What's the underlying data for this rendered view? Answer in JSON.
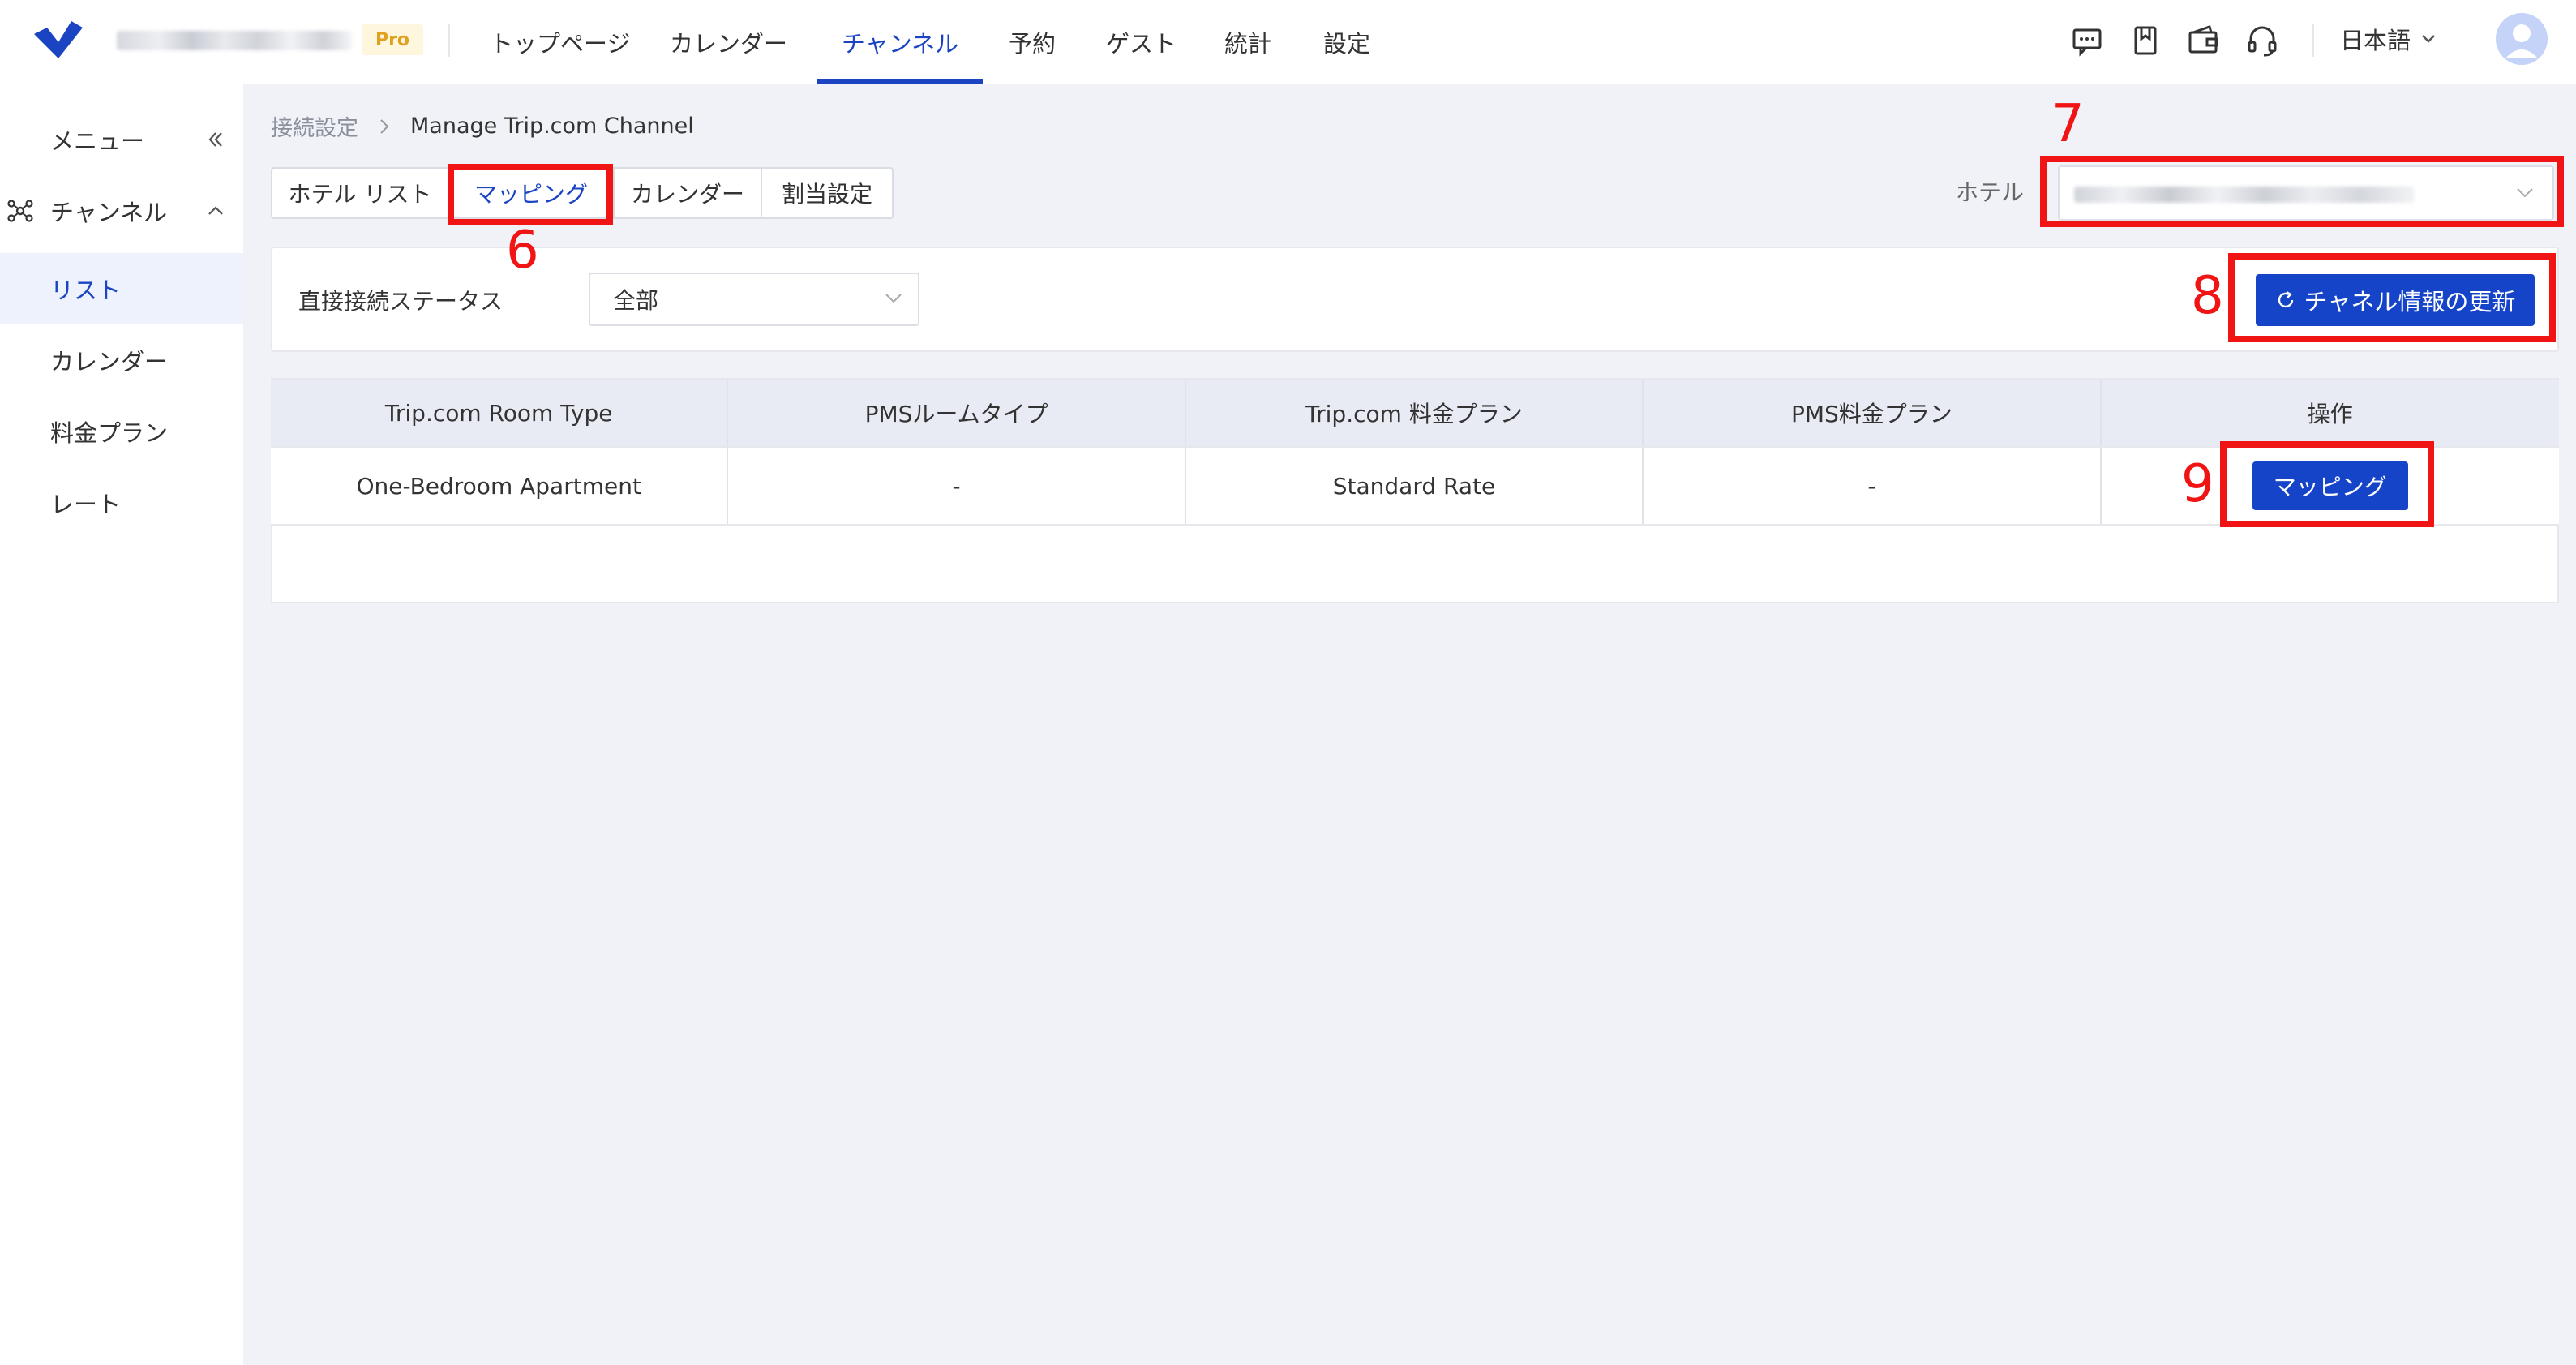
{
  "header": {
    "brand_name": "",
    "pro_badge": "Pro",
    "nav": [
      {
        "label": "トップページ",
        "active": false
      },
      {
        "label": "カレンダー",
        "active": false
      },
      {
        "label": "チャンネル",
        "active": true
      },
      {
        "label": "予約",
        "active": false
      },
      {
        "label": "ゲスト",
        "active": false
      },
      {
        "label": "統計",
        "active": false
      },
      {
        "label": "設定",
        "active": false
      }
    ],
    "icons": [
      "message-icon",
      "bookmark-icon",
      "wallet-icon",
      "headset-icon"
    ],
    "language": "日本語"
  },
  "sidebar": {
    "menu_label": "メニュー",
    "group_label": "チャンネル",
    "items": [
      {
        "label": "リスト",
        "active": true
      },
      {
        "label": "カレンダー",
        "active": false
      },
      {
        "label": "料金プラン",
        "active": false
      },
      {
        "label": "レート",
        "active": false
      }
    ]
  },
  "breadcrumb": {
    "parent": "接続設定",
    "current": "Manage Trip.com Channel"
  },
  "tabs": [
    {
      "label": "ホテル リスト",
      "active": false
    },
    {
      "label": "マッピング",
      "active": true
    },
    {
      "label": "カレンダー",
      "active": false
    },
    {
      "label": "割当設定",
      "active": false
    }
  ],
  "hotel_filter": {
    "label": "ホテル",
    "value": ""
  },
  "status_filter": {
    "label": "直接接続ステータス",
    "value": "全部"
  },
  "update_button": "チャネル情報の更新",
  "table": {
    "headers": [
      "Trip.com Room Type",
      "PMSルームタイプ",
      "Trip.com 料金プラン",
      "PMS料金プラン",
      "操作"
    ],
    "rows": [
      {
        "trip_room_type": "One-Bedroom Apartment",
        "pms_room_type": "-",
        "trip_rate_plan": "Standard Rate",
        "pms_rate_plan": "-",
        "action": "マッピング"
      }
    ]
  },
  "annotations": [
    "6",
    "7",
    "8",
    "9"
  ],
  "colors": {
    "primary": "#1544c8",
    "annotation": "#f01414",
    "page_bg": "#f0f2f7",
    "pro_badge": "#e0a020"
  }
}
